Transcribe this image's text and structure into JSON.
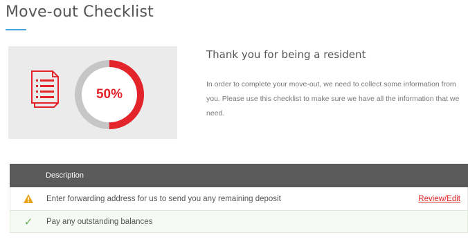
{
  "page": {
    "title": "Move-out Checklist"
  },
  "progress": {
    "percent_label": "50%",
    "percent": 50,
    "accent_color": "#e4242b",
    "icon": "document-list-icon"
  },
  "intro": {
    "heading": "Thank you for being a resident",
    "body": "In order to complete your move-out, we need to collect some information from you. Please use this checklist to make sure we have all the information that we need."
  },
  "table": {
    "header": "Description",
    "rows": [
      {
        "status": "warning",
        "status_icon": "warning-icon",
        "text": "Enter forwarding address for us to send you any remaining deposit",
        "action": "Review/Edit"
      },
      {
        "status": "complete",
        "status_icon": "checkmark-icon",
        "text": "Pay any outstanding balances",
        "action": ""
      }
    ]
  }
}
